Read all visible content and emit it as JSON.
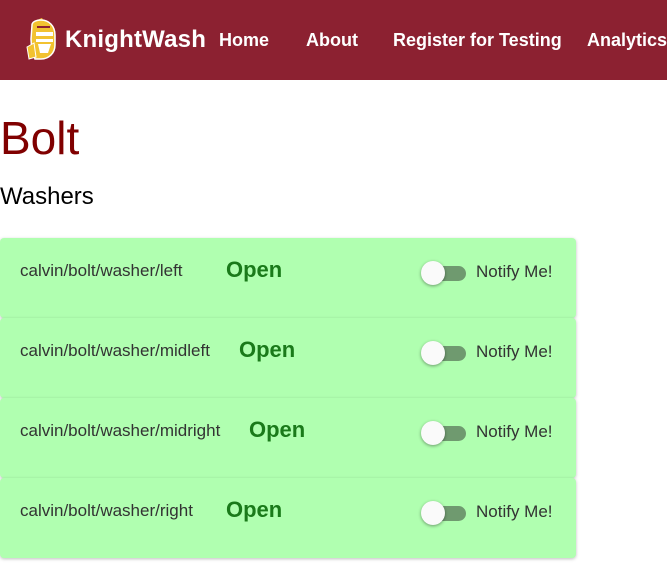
{
  "navbar": {
    "brand": "KnightWash",
    "links": [
      {
        "label": "Home"
      },
      {
        "label": "About"
      },
      {
        "label": "Register for Testing"
      },
      {
        "label": "Analytics"
      }
    ]
  },
  "page": {
    "title": "Bolt",
    "section": "Washers"
  },
  "machines": [
    {
      "name": "calvin/bolt/washer/left",
      "status": "Open",
      "notify_label": "Notify Me!",
      "notify_on": false
    },
    {
      "name": "calvin/bolt/washer/midleft",
      "status": "Open",
      "notify_label": "Notify Me!",
      "notify_on": false
    },
    {
      "name": "calvin/bolt/washer/midright",
      "status": "Open",
      "notify_label": "Notify Me!",
      "notify_on": false
    },
    {
      "name": "calvin/bolt/washer/right",
      "status": "Open",
      "notify_label": "Notify Me!",
      "notify_on": false
    }
  ],
  "colors": {
    "navbar": "#8c2131",
    "title": "#800000",
    "card_background": "#b0ffb0",
    "status_open": "#1a7a1a"
  },
  "icons": {
    "brand": "knight-helmet-icon"
  }
}
